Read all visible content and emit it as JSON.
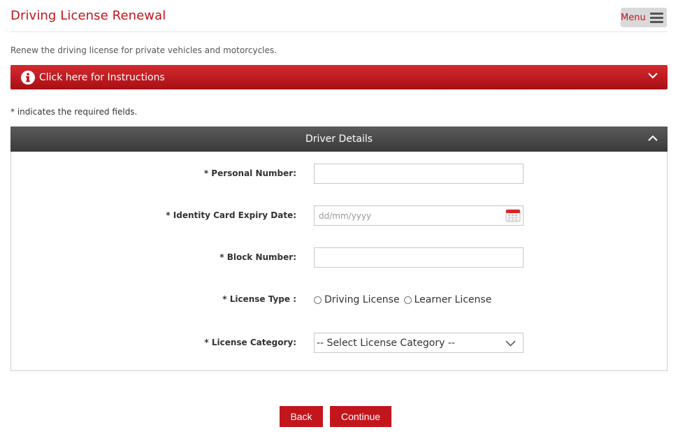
{
  "header": {
    "title": "Driving License Renewal",
    "menu_label": "Menu"
  },
  "subtitle": "Renew the driving license for private vehicles and motorcycles.",
  "instructions": {
    "label": "Click here for Instructions"
  },
  "required_note": "* indicates the required fields.",
  "panel": {
    "title": "Driver Details",
    "fields": {
      "personal_number": {
        "label": "* Personal Number:",
        "value": ""
      },
      "id_expiry": {
        "label": "* Identity Card Expiry Date:",
        "placeholder": "dd/mm/yyyy"
      },
      "block_number": {
        "label": "* Block Number:",
        "value": ""
      },
      "license_type": {
        "label": "* License Type :",
        "options": [
          "Driving License",
          "Learner License"
        ]
      },
      "license_category": {
        "label": "* License Category:",
        "selected": "-- Select License Category --"
      }
    }
  },
  "actions": {
    "back_label": "Back",
    "continue_label": "Continue"
  },
  "colors": {
    "brand_red": "#c3151c",
    "panel_header": "#464646"
  }
}
